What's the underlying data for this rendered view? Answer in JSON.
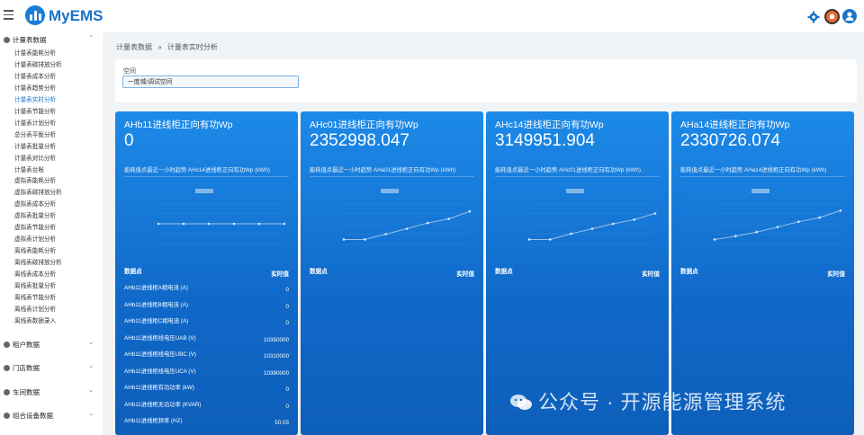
{
  "app": {
    "title": "MyEMS"
  },
  "breadcrumb": {
    "parent": "计量表数据",
    "separator": "»",
    "current": "计量表实时分析"
  },
  "filter": {
    "space_label": "空间",
    "space_value": "一度城/调试空间"
  },
  "sidebar": {
    "meter_group": "计量表数据",
    "meter_items": [
      "计量表能耗分析",
      "计量表碳排放分析",
      "计量表成本分析",
      "计量表趋势分析",
      "计量表实时分析",
      "计量表节能分析",
      "计量表计划分析",
      "总分表平衡分析",
      "计量表批量分析",
      "计量表对比分析",
      "计量表台账",
      "虚拟表能耗分析",
      "虚拟表碳排放分析",
      "虚拟表成本分析",
      "虚拟表批量分析",
      "虚拟表节能分析",
      "虚拟表计划分析",
      "离线表能耗分析",
      "离线表碳排放分析",
      "离线表成本分析",
      "离线表批量分析",
      "离线表节能分析",
      "离线表计划分析",
      "离线表数据录入"
    ],
    "active_index": 4,
    "other_groups": [
      "租户数据",
      "门店数据",
      "车间数据",
      "组合设备数据"
    ]
  },
  "cards": [
    {
      "title": "AHb11进线柜正向有功Wp",
      "value": "0",
      "subtitle": "能耗值点最近一小时趋势 AHc14进线柜正向有功Wp (kWh)",
      "chart": [
        0.5,
        0.5,
        0.5,
        0.5,
        0.5,
        0.5
      ],
      "points_header": "数据点",
      "value_header": "实时值",
      "points": [
        {
          "name": "AHb11进线柜A相电流 (A)",
          "value": "0"
        },
        {
          "name": "AHb11进线柜B相电流 (A)",
          "value": "0"
        },
        {
          "name": "AHb11进线柜C相电流 (A)",
          "value": "0"
        },
        {
          "name": "AHb11进线柜线电压UAB (V)",
          "value": "10350000"
        },
        {
          "name": "AHb11进线柜线电压UBC (V)",
          "value": "10310000"
        },
        {
          "name": "AHb11进线柜线电压UCA (V)",
          "value": "10390000"
        },
        {
          "name": "AHb11进线柜有功功率 (kW)",
          "value": "0"
        },
        {
          "name": "AHb11进线柜无功功率 (KVAR)",
          "value": "0"
        },
        {
          "name": "AHb11进线柜频率 (HZ)",
          "value": "50.03"
        }
      ]
    },
    {
      "title": "AHc01进线柜正向有功Wp",
      "value": "2352998.047",
      "subtitle": "能耗值点最近一小时趋势 AHa01进线柜正向有功Wp (kWh)",
      "chart": [
        0.12,
        0.12,
        0.25,
        0.38,
        0.52,
        0.62,
        0.8
      ],
      "points_header": "数据点",
      "value_header": "实时值",
      "points": []
    },
    {
      "title": "AHc14进线柜正向有功Wp",
      "value": "3149951.904",
      "subtitle": "能耗值点最近一小时趋势 AHc01进线柜正向有功Wp (kWh)",
      "chart": [
        0.12,
        0.12,
        0.26,
        0.38,
        0.5,
        0.6,
        0.75
      ],
      "points_header": "数据点",
      "value_header": "实时值",
      "points": []
    },
    {
      "title": "AHa14进线柜正向有功Wp",
      "value": "2330726.074",
      "subtitle": "能耗值点最近一小时趋势 AHa14进线柜正向有功Wp (kWh)",
      "chart": [
        0.12,
        0.2,
        0.3,
        0.42,
        0.55,
        0.65,
        0.82
      ],
      "points_header": "数据点",
      "value_header": "实时值",
      "points": []
    }
  ],
  "watermark": {
    "text": "公众号 · 开源能源管理系统"
  },
  "colors": {
    "card_blue": "#1a7fe0",
    "brand": "#1a73c8",
    "sidebar_active": "#1a73c8"
  },
  "icons": {
    "settings": "gear-icon",
    "notifications": "bell-icon",
    "user": "user-icon",
    "menu": "hamburger-icon"
  }
}
